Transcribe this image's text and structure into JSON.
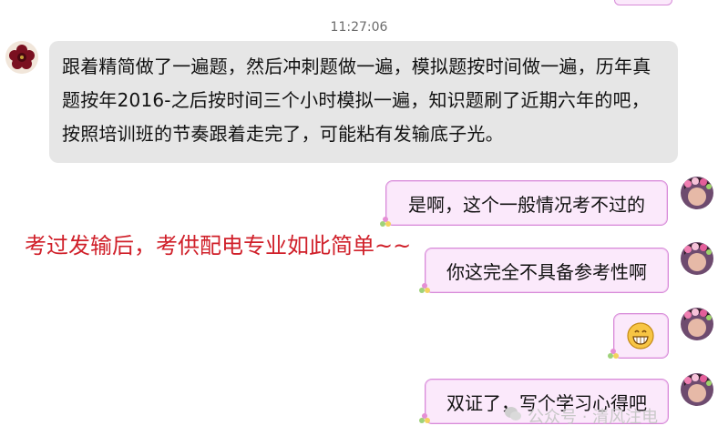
{
  "timestamp": "11:27:06",
  "messages": [
    {
      "side": "left",
      "text": "跟着精简做了一遍题，然后冲刺题做一遍，模拟题按时间做一遍，历年真题按年2016-之后按时间三个小时模拟一遍，知识题刷了近期六年的吧，按照培训班的节奏跟着走完了，可能粘有发输底子光。"
    },
    {
      "side": "right",
      "text": "是啊，这个一般情况考不过的"
    },
    {
      "side": "right",
      "text": "你这完全不具备参考性啊"
    },
    {
      "side": "right",
      "emoji": "grinning-face-icon"
    },
    {
      "side": "right",
      "text": "双证了，写个学习心得吧"
    }
  ],
  "annotation": "考过发输后，考供配电专业如此简单~~",
  "watermark": "公众号 · 清风注电",
  "colors": {
    "left_bubble": "#e6e6e6",
    "right_bubble": "#fbe9fb",
    "right_border": "#d78bd8",
    "annotation": "#d0202a"
  }
}
